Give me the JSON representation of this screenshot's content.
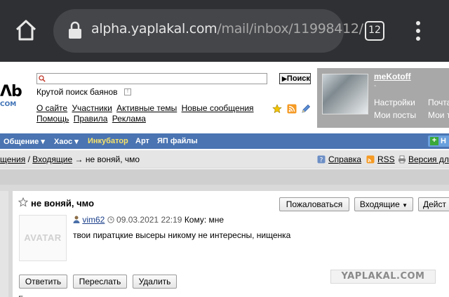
{
  "browser": {
    "url_host": "alpha.yaplakal.com",
    "url_path": "/mail/inbox/11998412/",
    "tab_count": "12"
  },
  "site": {
    "logo_text": "Λb",
    "logo_sub": "COM",
    "search": {
      "placeholder": "",
      "button_label": "Поиск",
      "button_arrow": "▶"
    },
    "slogan": "Крутой поиск баянов",
    "info_badge": "!",
    "nav_row1": [
      "О сайте",
      "Участники",
      "Активные темы",
      "Новые сообщения"
    ],
    "nav_row2": [
      "Помощь",
      "Правила",
      "Реклама"
    ]
  },
  "user": {
    "name": "meKotoff",
    "dot": "-",
    "links": [
      "Настройки",
      "Почта",
      "Мои посты",
      "Мои т"
    ]
  },
  "menu": {
    "items": [
      "Общение ▾",
      "Хаос ▾",
      "Инкубатор",
      "Арт",
      "ЯП файлы"
    ],
    "new_button": "Н"
  },
  "breadcrumb": {
    "part1": "щения",
    "sep": " / ",
    "part2": "Входящие",
    "arrow": " → ",
    "current": "не воняй, чмо"
  },
  "toplinks": [
    "Справка",
    "RSS",
    "Версия дл"
  ],
  "message": {
    "subject": "не воняй, чмо",
    "buttons": {
      "complain": "Пожаловаться",
      "inbox": "Входящие",
      "actions": "Дейст"
    },
    "avatar_placeholder": "AVATAR",
    "author": "vim62",
    "date": "09.03.2021 22:19",
    "to_label": "Кому: мне",
    "text": "твои пиратцкие высеры никому не интересны, нищенка",
    "reply_buttons": [
      "Ответить",
      "Переслать",
      "Удалить"
    ],
    "watermark": "YAPLAKAL.COM",
    "footer_text": "Б"
  },
  "colors": {
    "chrome_bg": "#2f3033",
    "menu_bg": "#4a74b2",
    "menu_highlight": "#f8e36a",
    "userpanel_bg": "#a8a8a8",
    "author_link": "#1a3f8a"
  }
}
